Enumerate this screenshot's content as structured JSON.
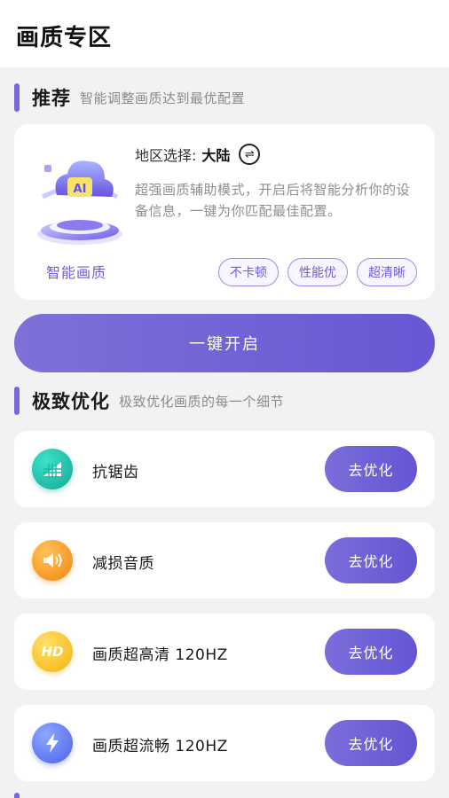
{
  "header": {
    "title": "画质专区"
  },
  "recommend": {
    "title": "推荐",
    "subtitle": "智能调整画质达到最优配置",
    "ai_label": "智能画质",
    "region_label": "地区选择:",
    "region_value": "大陆",
    "description": "超强画质辅助模式，开启后将智能分析你的设备信息，一键为你匹配最佳配置。",
    "tags": [
      "不卡顿",
      "性能优",
      "超清晰"
    ],
    "enable_label": "一键开启"
  },
  "optimize": {
    "title": "极致优化",
    "subtitle": "极致优化画质的每一个细节",
    "items": [
      {
        "label": "抗锯齿",
        "button": "去优化",
        "icon": "signal-bars-icon",
        "color": "#12a996"
      },
      {
        "label": "减损音质",
        "button": "去优化",
        "icon": "speaker-icon",
        "color": "#f2860e"
      },
      {
        "label": "画质超高清 120HZ",
        "button": "去优化",
        "icon": "hd-icon",
        "icon_text": "HD",
        "color": "#f3b312"
      },
      {
        "label": "画质超流畅 120HZ",
        "button": "去优化",
        "icon": "lightning-icon",
        "color": "#4a63e8"
      }
    ]
  },
  "colors": {
    "accent": "#6b5fd0",
    "button": "#6757d4",
    "background": "#f2f2f4"
  }
}
